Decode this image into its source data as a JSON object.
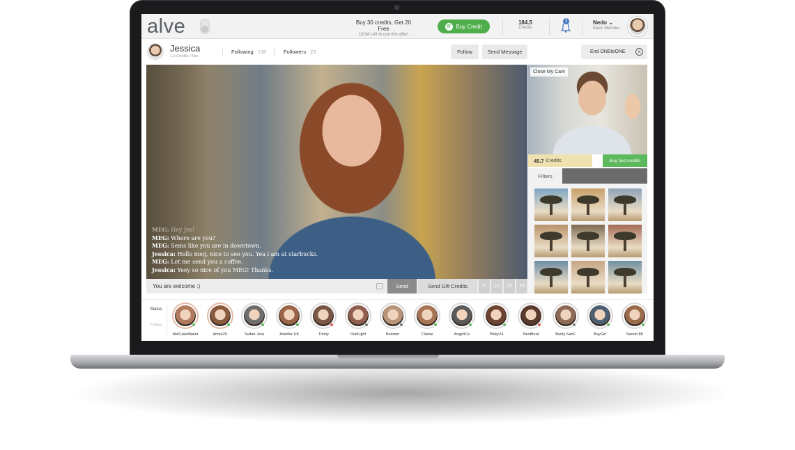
{
  "topbar": {
    "logo": "alve",
    "offer_main": "Buy 30 credits, Get 20 Free",
    "offer_sub": "18:04  Left to use this offer!",
    "buy_credit": "Buy Credit",
    "credits_value": "184.5",
    "credits_label": "Credits",
    "notifications_count": "3",
    "user_name": "Nedo",
    "user_role": "Basic Member"
  },
  "profile": {
    "name": "Jessica",
    "rate": "1.3 Credits / Min.",
    "following_label": "Following",
    "following_count": "198",
    "followers_label": "Followers",
    "followers_count": "23",
    "follow_btn": "Follow",
    "send_message_btn": "Send Message",
    "end_btn": "End ONEtoONE"
  },
  "chat": {
    "lines": [
      {
        "sender": "MEG:",
        "text": " Hey Jes!",
        "dim": true
      },
      {
        "sender": "MEG:",
        "text": "  Where are you?",
        "dim": false
      },
      {
        "sender": "MEG:",
        "text": " Sems like you are in downtown.",
        "dim": false
      },
      {
        "sender": "Jessica:",
        "text": " Hello meg, nice to see you. Yea i am at starbucks.",
        "dim": false
      },
      {
        "sender": "MEG:",
        "text": " Let me send you a coffee.",
        "dim": false
      },
      {
        "sender": "Jessica:",
        "text": " Yeey so nice of you MEG! Thanks.",
        "dim": false
      }
    ],
    "input_value": "You are welcome :)",
    "send_btn": "Send",
    "gift_btn": "Send Gift Credits",
    "gift_amounts": [
      "5",
      "10",
      "15",
      "25"
    ]
  },
  "mycam": {
    "close_label": "Close My Cam",
    "credits_value": "45.7",
    "credits_label": "Credits",
    "buy_fast": "Buy fast credits",
    "filters_tab": "Filters",
    "filter_tints": [
      "#7fa6c4",
      "#c9a06a",
      "#8fa3b8",
      "#b9936a",
      "#7f6a52",
      "#a56b56",
      "#6f8da3",
      "#c7a585",
      "#6e8fa0"
    ]
  },
  "strip": {
    "status_tab": "Status",
    "follow_tab": "Follow",
    "profiles": [
      {
        "name": "MelCakeMaker",
        "status": "#5cb85c",
        "active": true,
        "tint": "#b07a5c"
      },
      {
        "name": "Annie29",
        "status": "#5cb85c",
        "active": true,
        "tint": "#8a5a3c"
      },
      {
        "name": "Sultan Jess",
        "status": "#5cb85c",
        "active": false,
        "tint": "#6e6e6e"
      },
      {
        "name": "Jennifer-UK",
        "status": "#5cb85c",
        "active": false,
        "tint": "#9a6446"
      },
      {
        "name": "Trinity",
        "status": "#d9534f",
        "active": false,
        "tint": "#7a5646"
      },
      {
        "name": "RedLight",
        "status": "#777777",
        "active": false,
        "tint": "#8f5e4e"
      },
      {
        "name": "Boomer",
        "status": "#777777",
        "active": false,
        "tint": "#b89478"
      },
      {
        "name": "Clarise",
        "status": "#5cb85c",
        "active": false,
        "tint": "#a77455"
      },
      {
        "name": "AngeliCa",
        "status": "#5cb85c",
        "active": false,
        "tint": "#5a5a5a"
      },
      {
        "name": "Pinky24",
        "status": "#5cb85c",
        "active": false,
        "tint": "#6e4230"
      },
      {
        "name": "NextBeat",
        "status": "#d9534f",
        "active": false,
        "tint": "#5b3a2e"
      },
      {
        "name": "Benly-SanF",
        "status": "#777777",
        "active": false,
        "tint": "#8d6a55"
      },
      {
        "name": "BayGirl",
        "status": "#5cb85c",
        "active": false,
        "tint": "#4f5f73"
      },
      {
        "name": "Secret 88",
        "status": "#5cb85c",
        "active": false,
        "tint": "#9a6a4a"
      }
    ]
  }
}
